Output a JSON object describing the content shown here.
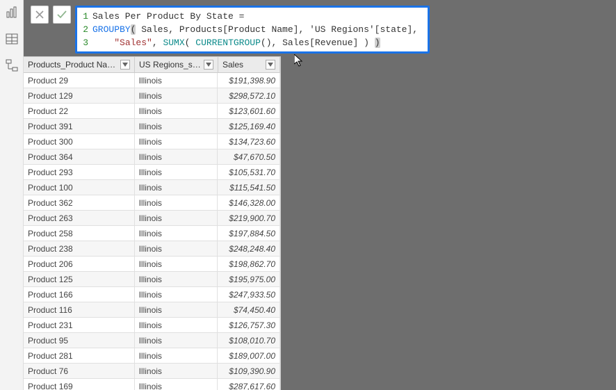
{
  "rail": {
    "items": [
      "report-icon",
      "data-icon",
      "model-icon"
    ]
  },
  "formula": {
    "line1_prefix": "Sales Per Product By State ",
    "equals": "=",
    "line2_kw": "GROUPBY",
    "line2_rest": " Sales, Products[Product Name], 'US Regions'[state],",
    "line3_indent": "    ",
    "line3_str": "\"Sales\"",
    "line3_sep": ", ",
    "line3_sumx": "SUMX",
    "line3_open": "( ",
    "line3_curgroup": "CURRENTGROUP",
    "line3_cg_paren": "()",
    "line3_mid": ", Sales[Revenue] ) ",
    "line3_close": ")",
    "gutter": [
      "1",
      "2",
      "3"
    ]
  },
  "grid": {
    "headers": {
      "c1": "Products_Product Name",
      "c2": "US Regions_state",
      "c3": "Sales"
    },
    "rows": [
      {
        "p": "Product 29",
        "s": "Illinois",
        "v": "$191,398.90"
      },
      {
        "p": "Product 129",
        "s": "Illinois",
        "v": "$298,572.10"
      },
      {
        "p": "Product 22",
        "s": "Illinois",
        "v": "$123,601.60"
      },
      {
        "p": "Product 391",
        "s": "Illinois",
        "v": "$125,169.40"
      },
      {
        "p": "Product 300",
        "s": "Illinois",
        "v": "$134,723.60"
      },
      {
        "p": "Product 364",
        "s": "Illinois",
        "v": "$47,670.50"
      },
      {
        "p": "Product 293",
        "s": "Illinois",
        "v": "$105,531.70"
      },
      {
        "p": "Product 100",
        "s": "Illinois",
        "v": "$115,541.50"
      },
      {
        "p": "Product 362",
        "s": "Illinois",
        "v": "$146,328.00"
      },
      {
        "p": "Product 263",
        "s": "Illinois",
        "v": "$219,900.70"
      },
      {
        "p": "Product 258",
        "s": "Illinois",
        "v": "$197,884.50"
      },
      {
        "p": "Product 238",
        "s": "Illinois",
        "v": "$248,248.40"
      },
      {
        "p": "Product 206",
        "s": "Illinois",
        "v": "$198,862.70"
      },
      {
        "p": "Product 125",
        "s": "Illinois",
        "v": "$195,975.00"
      },
      {
        "p": "Product 166",
        "s": "Illinois",
        "v": "$247,933.50"
      },
      {
        "p": "Product 116",
        "s": "Illinois",
        "v": "$74,450.40"
      },
      {
        "p": "Product 231",
        "s": "Illinois",
        "v": "$126,757.30"
      },
      {
        "p": "Product 95",
        "s": "Illinois",
        "v": "$108,010.70"
      },
      {
        "p": "Product 281",
        "s": "Illinois",
        "v": "$189,007.00"
      },
      {
        "p": "Product 76",
        "s": "Illinois",
        "v": "$109,390.90"
      },
      {
        "p": "Product 169",
        "s": "Illinois",
        "v": "$287,617.60"
      }
    ]
  }
}
